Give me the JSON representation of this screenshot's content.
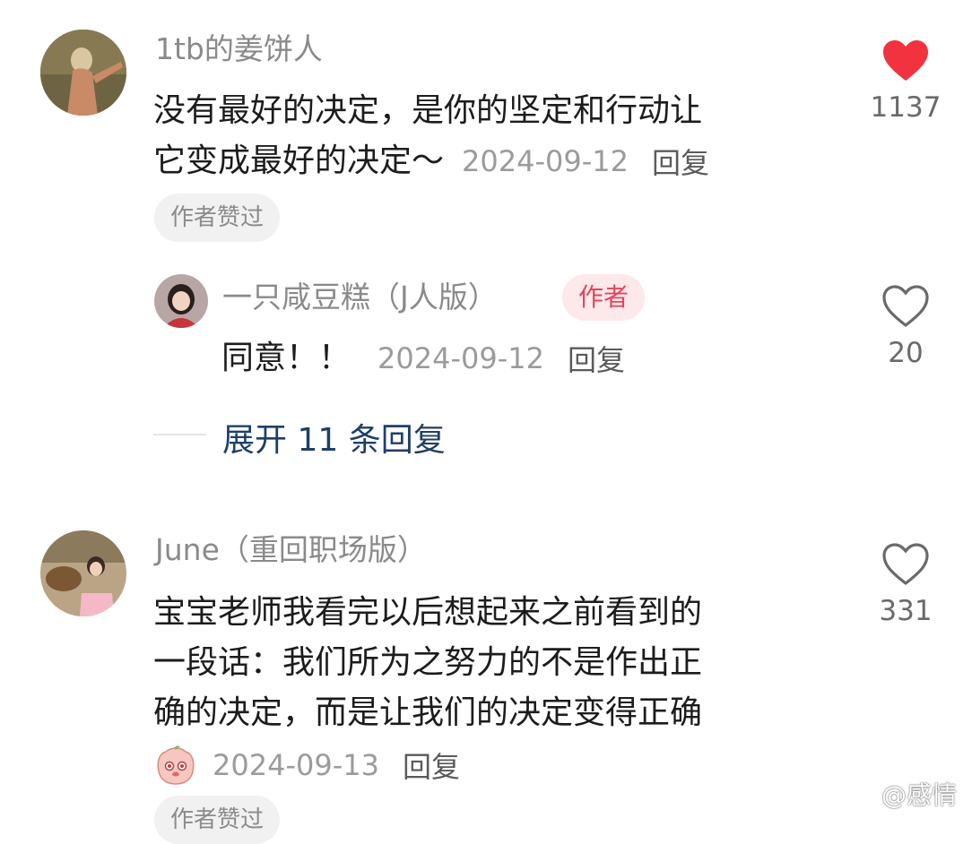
{
  "comments": [
    {
      "username": "1tb的姜饼人",
      "text_line1": "没有最好的决定，是你的坚定和行动让",
      "text_line2": "它变成最好的决定～",
      "date": "2024-09-12",
      "reply_label": "回复",
      "badge": "作者赞过",
      "like_count": "1137",
      "liked": true,
      "replies": [
        {
          "username": "一只咸豆糕（J人版）",
          "author_tag": "作者",
          "text": "同意！！",
          "date": "2024-09-12",
          "reply_label": "回复",
          "like_count": "20",
          "liked": false
        }
      ],
      "expand_label": "展开 11 条回复"
    },
    {
      "username": "June（重回职场版）",
      "text_line1": "宝宝老师我看完以后想起来之前看到的",
      "text_line2": "一段话：我们所为之努力的不是作出正",
      "text_line3": "确的决定，而是让我们的决定变得正确",
      "date": "2024-09-13",
      "reply_label": "回复",
      "badge": "作者赞过",
      "like_count": "331",
      "liked": false,
      "sticker_icon": "peach-face-sticker-icon"
    }
  ],
  "watermark": "@感情",
  "colors": {
    "like_red": "#f2323f",
    "author_badge_bg": "#fde8ea",
    "author_badge_text": "#e4455a",
    "expand_link": "#1f3f66"
  },
  "icons": {
    "heart_filled": "heart-filled-icon",
    "heart_outline": "heart-outline-icon"
  }
}
